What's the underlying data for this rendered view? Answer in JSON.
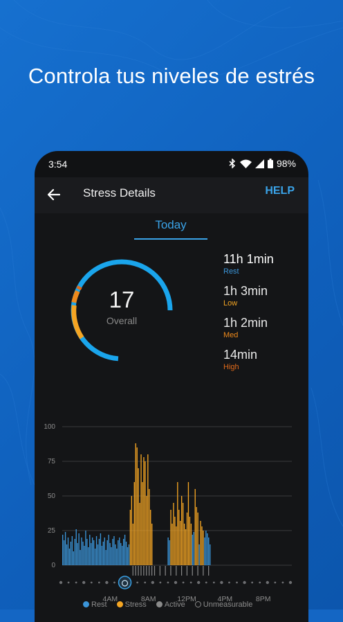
{
  "headline": "Controla tus niveles de estrés",
  "status_bar": {
    "time": "3:54",
    "battery": "98%"
  },
  "app_bar": {
    "title": "Stress Details",
    "help": "HELP"
  },
  "tabs": [
    {
      "label": "Today",
      "active": true
    }
  ],
  "summary": {
    "overall_value": "17",
    "overall_label": "Overall",
    "stats": [
      {
        "value": "11h 1min",
        "category": "Rest",
        "color": "#3b95d9"
      },
      {
        "value": "1h 3min",
        "category": "Low",
        "color": "#f4a523"
      },
      {
        "value": "1h 2min",
        "category": "Med",
        "color": "#ee8a1c"
      },
      {
        "value": "14min",
        "category": "High",
        "color": "#e06a1a"
      }
    ]
  },
  "colors": {
    "rest": "#3b95d9",
    "stress": "#f4a523",
    "active": "#8a8a8a",
    "accent": "#3aa3e8"
  },
  "chart_data": {
    "type": "bar",
    "ylim": [
      0,
      100
    ],
    "y_ticks": [
      "100",
      "75",
      "50",
      "25",
      "0"
    ],
    "x_tick_labels": [
      "4AM",
      "8AM",
      "12PM",
      "4PM",
      "8PM"
    ],
    "legend": [
      "Rest",
      "Stress",
      "Active",
      "Unmeasurable"
    ],
    "series": [
      {
        "name": "Rest",
        "values": [
          22,
          18,
          24,
          15,
          20,
          12,
          17,
          21,
          10,
          19,
          26,
          16,
          23,
          11,
          20,
          17,
          14,
          25,
          19,
          13,
          22,
          16,
          20,
          18,
          12,
          21,
          15,
          19,
          23,
          14,
          17,
          20,
          11,
          18,
          22,
          16,
          13,
          19,
          21,
          15,
          12,
          18,
          20,
          16,
          14,
          19,
          22,
          17,
          13,
          15,
          0,
          0,
          0,
          0,
          0,
          0,
          0,
          0,
          0,
          0,
          0,
          0,
          0,
          0,
          0,
          0,
          0,
          0,
          0,
          0,
          0,
          0,
          0,
          0,
          0,
          0,
          0,
          0,
          20,
          18,
          0,
          0,
          0,
          0,
          0,
          0,
          0,
          0,
          0,
          0,
          0,
          0,
          0,
          0,
          0,
          0,
          22,
          24,
          0,
          0,
          0,
          15,
          0,
          0,
          0,
          20,
          25,
          23,
          20,
          15
        ]
      },
      {
        "name": "Stress",
        "values": [
          0,
          0,
          0,
          0,
          0,
          0,
          0,
          0,
          0,
          0,
          0,
          0,
          0,
          0,
          0,
          0,
          0,
          0,
          0,
          0,
          0,
          0,
          0,
          0,
          0,
          0,
          0,
          0,
          0,
          0,
          0,
          0,
          0,
          0,
          0,
          0,
          0,
          0,
          0,
          0,
          0,
          0,
          0,
          0,
          0,
          0,
          0,
          0,
          0,
          0,
          40,
          50,
          30,
          60,
          88,
          85,
          70,
          45,
          80,
          60,
          78,
          75,
          50,
          80,
          55,
          40,
          30,
          0,
          0,
          0,
          0,
          0,
          0,
          0,
          0,
          0,
          0,
          0,
          0,
          0,
          40,
          30,
          45,
          35,
          28,
          60,
          40,
          32,
          50,
          45,
          30,
          26,
          38,
          60,
          35,
          30,
          0,
          0,
          55,
          42,
          38,
          0,
          32,
          28,
          25,
          0,
          0,
          0,
          0,
          0
        ]
      }
    ],
    "timeline_dots": 31,
    "timeline_marker_index": 8
  }
}
